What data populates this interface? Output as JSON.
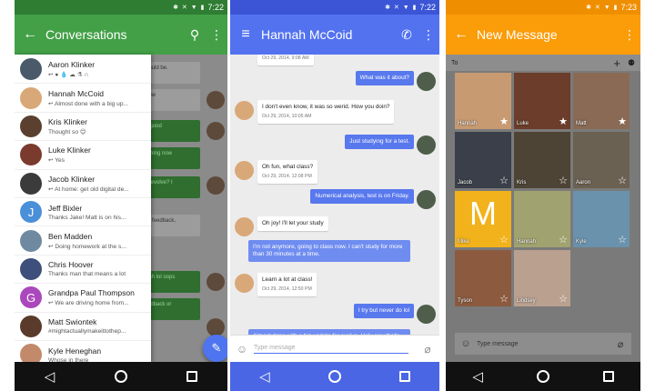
{
  "phone1": {
    "time": "7:22",
    "title": "Conversations",
    "conversations": [
      {
        "name": "Aaron Klinker",
        "snippet": "↩ ● 💧 ☁ ⚗ ∩",
        "avatar_color": "#4b5a6a",
        "initial": ""
      },
      {
        "name": "Hannah McCoid",
        "snippet": "↩ Almost done with a big up...",
        "avatar_color": "#d9a878",
        "initial": ""
      },
      {
        "name": "Kris Klinker",
        "snippet": "Thought so 😊",
        "avatar_color": "#5b4030",
        "initial": ""
      },
      {
        "name": "Luke Klinker",
        "snippet": "↩ Yes",
        "avatar_color": "#7a3b2e",
        "initial": ""
      },
      {
        "name": "Jacob Klinker",
        "snippet": "↩ At home: get old digital de...",
        "avatar_color": "#3b3b3b",
        "initial": ""
      },
      {
        "name": "Jeff Bixler",
        "snippet": "Thanks Jake! Matt is on his...",
        "avatar_color": "#4a90d9",
        "initial": "J"
      },
      {
        "name": "Ben Madden",
        "snippet": "↩ Doing homework at the s...",
        "avatar_color": "#6f8aa0",
        "initial": ""
      },
      {
        "name": "Chris Hoover",
        "snippet": "Thanks man that means a lot",
        "avatar_color": "#3d4f7a",
        "initial": ""
      },
      {
        "name": "Grandpa Paul Thompson",
        "snippet": "↩ We are driving home from...",
        "avatar_color": "#ab47bc",
        "initial": "G"
      },
      {
        "name": "Matt Swiontek",
        "snippet": "#mightactuallymakeittothep...",
        "avatar_color": "#5a3a2a",
        "initial": ""
      },
      {
        "name": "Kyle Heneghan",
        "snippet": "Whose in there",
        "avatar_color": "#c28a6a",
        "initial": ""
      }
    ],
    "background_snippets": [
      "should be.",
      "know",
      "t's good",
      "coming now",
      "for evolve? I",
      "that I just put",
      "me feedback,",
      "yeah lol oops",
      "feedback or",
      "ween those"
    ]
  },
  "phone2": {
    "time": "7:22",
    "title": "Hannah McCoid",
    "top_time": "Oct 29, 2014, 9:08 AM",
    "messages": [
      {
        "dir": "out",
        "text": "What was it about?"
      },
      {
        "dir": "in",
        "text": "I don't even know, it was so werid. How you doin?",
        "time": "Oct 29, 2014, 10:05 AM"
      },
      {
        "dir": "out",
        "text": "Just studying for a test."
      },
      {
        "dir": "in",
        "text": "Oh fun, what class?",
        "time": "Oct 29, 2014, 12:08 PM"
      },
      {
        "dir": "out",
        "text": "Numerical analysis, test is on Friday."
      },
      {
        "dir": "in",
        "text": "Oh joy! I'll let your study",
        "time": ""
      },
      {
        "dir": "in2",
        "text": "I'm not anymore, going to class now. I can't study for more than 30 minutes at a time.",
        "time": ""
      },
      {
        "dir": "in",
        "text": "Learn a lot at class!",
        "time": "Oct 29, 2014, 12:50 PM"
      },
      {
        "dir": "out",
        "text": "I try but never do lol"
      },
      {
        "dir": "in2",
        "text": "Almost done with a big update for evolve. Holy cow that's been a lot of work the past 2 weeks.",
        "time": "Oct 29, 2014, 4:52 PM"
      }
    ],
    "placeholder": "Type message"
  },
  "phone3": {
    "time": "7:23",
    "title": "New Message",
    "to_label": "To",
    "contacts": [
      {
        "name": "Hannah",
        "color": "#c79a72",
        "letter": "",
        "starred": true
      },
      {
        "name": "Luke",
        "color": "#6b3d2a",
        "letter": "",
        "starred": true
      },
      {
        "name": "Matt",
        "color": "#8a6a55",
        "letter": "",
        "starred": true
      },
      {
        "name": "Jacob",
        "color": "#3a3f4a",
        "letter": "",
        "starred": false
      },
      {
        "name": "Kris",
        "color": "#4d4436",
        "letter": "",
        "starred": false
      },
      {
        "name": "Aaron",
        "color": "#6b6152",
        "letter": "",
        "starred": false
      },
      {
        "name": "Mike",
        "color": "#f2b21b",
        "letter": "M",
        "starred": false
      },
      {
        "name": "Hannah",
        "color": "#a0a36f",
        "letter": "",
        "starred": false
      },
      {
        "name": "Kyle",
        "color": "#6a92ad",
        "letter": "",
        "starred": false
      },
      {
        "name": "Tyson",
        "color": "#8b5a3f",
        "letter": "",
        "starred": false
      },
      {
        "name": "Lindsey",
        "color": "#b9a08f",
        "letter": "",
        "starred": false
      }
    ],
    "placeholder": "Type message"
  }
}
